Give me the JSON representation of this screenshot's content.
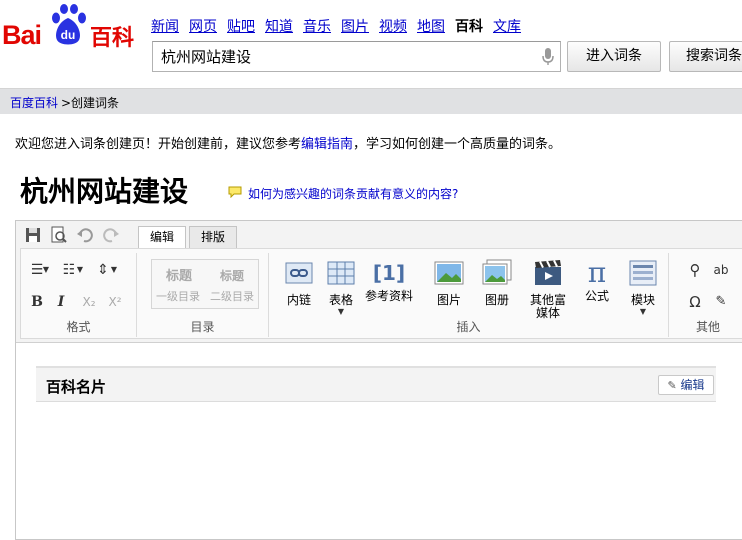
{
  "header": {
    "logo_text": "Bai",
    "logo_du": "du",
    "logo_product": "百科",
    "nav": [
      {
        "label": "新闻",
        "current": false
      },
      {
        "label": "网页",
        "current": false
      },
      {
        "label": "贴吧",
        "current": false
      },
      {
        "label": "知道",
        "current": false
      },
      {
        "label": "音乐",
        "current": false
      },
      {
        "label": "图片",
        "current": false
      },
      {
        "label": "视频",
        "current": false
      },
      {
        "label": "地图",
        "current": false
      },
      {
        "label": "百科",
        "current": true
      },
      {
        "label": "文库",
        "current": false
      }
    ],
    "search_value": "杭州网站建设",
    "enter_button": "进入词条",
    "search_button": "搜索词条"
  },
  "breadcrumb": {
    "home": "百度百科",
    "current": ">创建词条"
  },
  "welcome": {
    "before": "欢迎您进入词条创建页！开始创建前，建议您参考",
    "link": "编辑指南",
    "after": "，学习如何创建一个高质量的词条。"
  },
  "page_title": "杭州网站建设",
  "tip_link": "如何为感兴趣的词条贡献有意义的内容?",
  "editor": {
    "tabs": [
      {
        "label": "编辑",
        "active": true
      },
      {
        "label": "排版",
        "active": false
      }
    ],
    "groups": {
      "format": "格式",
      "toc": "目录",
      "insert": "插入",
      "other": "其他"
    },
    "heading1": "标题",
    "heading1_sub": "一级目录",
    "heading2": "标题",
    "heading2_sub": "二级目录",
    "insert_items": [
      "内链",
      "表格",
      "参考资料",
      "图片",
      "图册",
      "其他富媒体",
      "公式",
      "模块"
    ],
    "ref_icon_text": "[1]",
    "formula_icon_text": "π",
    "omega_text": "Ω",
    "card_title": "百科名片",
    "card_edit": "编辑"
  }
}
